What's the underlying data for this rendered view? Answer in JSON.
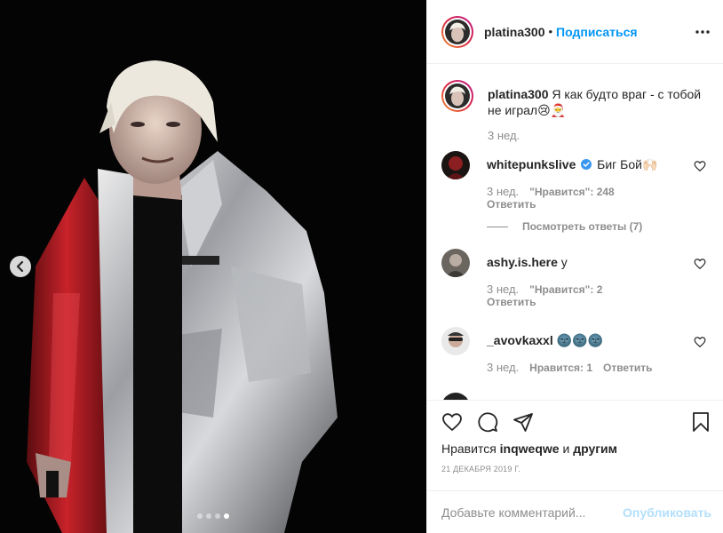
{
  "post": {
    "author": "platina300",
    "separator": "•",
    "follow_label": "Подписаться",
    "more_icon": "more-horizontal-icon",
    "caption": {
      "user": "platina300",
      "text": "Я как будто враг - с тобой не играл😢🎅",
      "time": "3 нед."
    },
    "comments": [
      {
        "user": "whitepunkslive",
        "verified": true,
        "text": "Биг Бой🙌🏻",
        "time": "3 нед.",
        "likes": "\"Нравится\": 248",
        "reply": "Ответить",
        "view_replies": "Посмотреть ответы (7)"
      },
      {
        "user": "ashy.is.here",
        "verified": false,
        "text": "у",
        "time": "3 нед.",
        "likes": "\"Нравится\": 2",
        "reply": "Ответить"
      },
      {
        "user": "_avovkaxxl",
        "verified": false,
        "text": "🌚🌚🌚",
        "time": "3 нед.",
        "likes": "Нравится: 1",
        "reply": "Ответить"
      }
    ],
    "likes_prefix": "Нравится",
    "likes_user": "inqweqwe",
    "likes_and": "и",
    "likes_others": "другим",
    "date": "21 декабря 2019 г.",
    "comment_placeholder": "Добавьте комментарий...",
    "publish_label": "Опубликовать",
    "carousel": {
      "total": 4,
      "active": 4
    },
    "colors": {
      "accent": "#0095f6",
      "publish_disabled": "#b2dffc",
      "muted": "#8e8e8e"
    }
  }
}
